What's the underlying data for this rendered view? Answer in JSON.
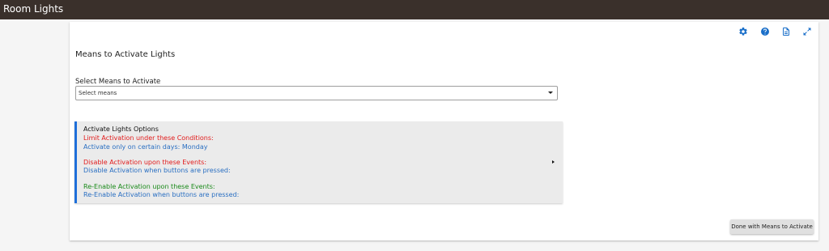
{
  "app": {
    "title": "Room Lights"
  },
  "toolbar": {
    "icons": [
      "gear-icon",
      "help-icon",
      "document-icon",
      "expand-icon"
    ],
    "icon_color": "#1a6fc9"
  },
  "section": {
    "title": "Means to Activate Lights"
  },
  "select": {
    "label": "Select Means to Activate",
    "value": "Select means"
  },
  "options": {
    "title": "Activate Lights Options",
    "limit_heading": "Limit Activation under these Conditions:",
    "limit_detail": "Activate only on certain days: Monday",
    "disable_heading": "Disable Activation upon these Events:",
    "disable_detail": "Disable Activation when buttons are pressed:",
    "reenable_heading": "Re-Enable Activation upon these Events:",
    "reenable_detail": "Re-Enable Activation when buttons are pressed:"
  },
  "footer": {
    "done_label": "Done with Means to Activate"
  },
  "colors": {
    "topbar": "#3a302b",
    "accent_blue": "#1e6fd9",
    "red": "#e21b1b",
    "green": "#1a8a1a",
    "blue_text": "#2a6fc2"
  }
}
